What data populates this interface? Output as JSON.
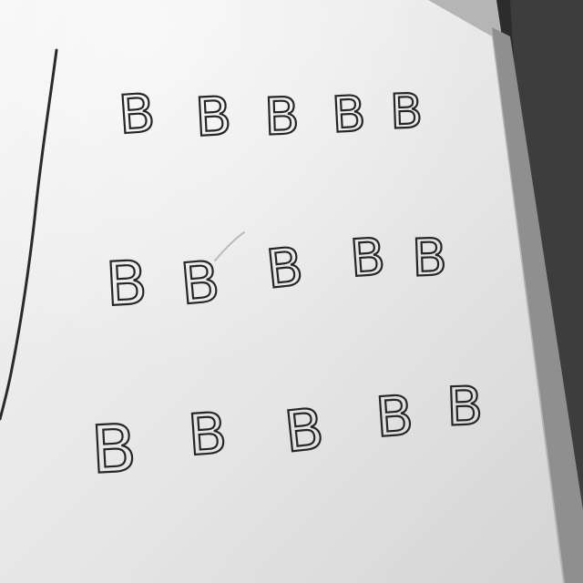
{
  "photo": {
    "subject": "whiteboard with handwritten letters",
    "tone": "grayscale",
    "colors": {
      "board": "#ececec",
      "board_shadow": "#d2d2d2",
      "ink": "#262626",
      "frame": "#b8b8b8",
      "background_dark": "#2a2a2a"
    }
  },
  "board": {
    "rows": [
      {
        "letters": [
          "B",
          "B",
          "B",
          "B",
          "B"
        ]
      },
      {
        "letters": [
          "B",
          "B",
          "B",
          "B",
          "B"
        ]
      },
      {
        "letters": [
          "B",
          "B",
          "B",
          "B",
          "B"
        ]
      }
    ]
  }
}
